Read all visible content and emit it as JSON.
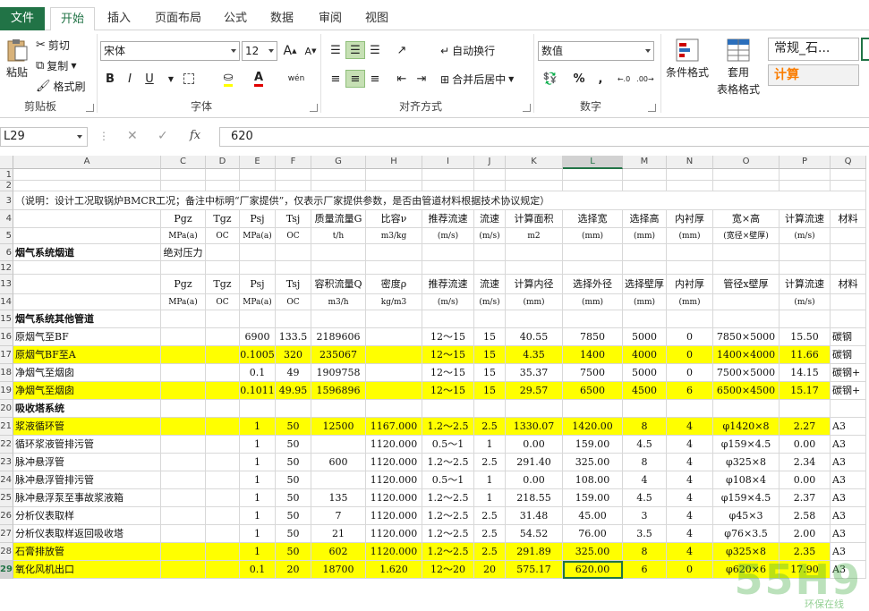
{
  "tabs": [
    {
      "label": "文件",
      "key": "file"
    },
    {
      "label": "开始",
      "key": "home",
      "active": true
    },
    {
      "label": "插入",
      "key": "insert"
    },
    {
      "label": "页面布局",
      "key": "layout"
    },
    {
      "label": "公式",
      "key": "formulas"
    },
    {
      "label": "数据",
      "key": "data"
    },
    {
      "label": "审阅",
      "key": "review"
    },
    {
      "label": "视图",
      "key": "view"
    }
  ],
  "ribbon": {
    "clipboard": {
      "paste": "粘贴",
      "cut": "剪切",
      "copy": "复制",
      "format_painter": "格式刷",
      "label": "剪贴板"
    },
    "font": {
      "name": "宋体",
      "size": "12",
      "label": "字体",
      "bold": "B",
      "italic": "I",
      "underline": "U",
      "grow": "A",
      "shrink": "A",
      "phonetic": "wén"
    },
    "alignment": {
      "wrap": "自动换行",
      "merge": "合并后居中",
      "label": "对齐方式"
    },
    "number": {
      "format": "数值",
      "percent": "%",
      "comma": ",",
      "label": "数字"
    },
    "styles": {
      "conditional": "条件格式",
      "table_format_1": "套用",
      "table_format_2": "表格格式",
      "style_normal": "常规_石...",
      "style_calc": "计算"
    }
  },
  "formula_bar": {
    "name_box": "L29",
    "cancel": "✕",
    "confirm": "✓",
    "fx": "fx",
    "value": "620"
  },
  "columns": [
    "A",
    "C",
    "D",
    "E",
    "F",
    "G",
    "H",
    "I",
    "J",
    "K",
    "L",
    "M",
    "N",
    "O",
    "P",
    "Q"
  ],
  "rows": {
    "r1": "1",
    "r2": "2",
    "r3": "3",
    "r4": "4",
    "r5": "5",
    "r6": "6",
    "r12": "12",
    "r13": "13",
    "r14": "14",
    "r15": "15",
    "r16": "16",
    "r17": "17",
    "r18": "18",
    "r19": "19",
    "r20": "20",
    "r21": "21",
    "r22": "22",
    "r23": "23",
    "r24": "24",
    "r25": "25",
    "r26": "26",
    "r27": "27",
    "r28": "28",
    "r29": "29"
  },
  "sheet": {
    "note": "（说明：设计工况取锅炉BMCR工况；备注中标明“厂家提供”，仅表示厂家提供参数，是否由管道材料根据技术协议规定）",
    "hdr1": {
      "c": "Pgz",
      "d": "Tgz",
      "e": "Psj",
      "f": "Tsj",
      "g": "质量流量G",
      "h": "比容ν",
      "i": "推荐流速",
      "j": "流速",
      "k": "计算面积",
      "l": "选择宽",
      "m": "选择高",
      "n": "内衬厚",
      "o": "宽×高",
      "p": "计算流速",
      "q": "材料"
    },
    "hdr1u": {
      "c": "MPa(a)",
      "d": "OC",
      "e": "MPa(a)",
      "f": "OC",
      "g": "t/h",
      "h": "m3/kg",
      "i": "(m/s)",
      "j": "(m/s)",
      "k": "m2",
      "l": "(mm)",
      "m": "(mm)",
      "n": "(mm)",
      "o": "(宽径×壁厚)",
      "p": "(m/s)"
    },
    "section1": "烟气系统烟道",
    "abs_pressure": "绝对压力",
    "hdr2": {
      "c": "Pgz",
      "d": "Tgz",
      "e": "Psj",
      "f": "Tsj",
      "g": "容积流量Q",
      "h": "密度ρ",
      "i": "推荐流速",
      "j": "流速",
      "k": "计算内径",
      "l": "选择外径",
      "m": "选择壁厚",
      "n": "内衬厚",
      "o": "管径x壁厚",
      "p": "计算流速",
      "q": "材料"
    },
    "hdr2u": {
      "c": "MPa(a)",
      "d": "OC",
      "e": "MPa(a)",
      "f": "OC",
      "g": "m3/h",
      "h": "kg/m3",
      "i": "(m/s)",
      "j": "(m/s)",
      "k": "(mm)",
      "l": "(mm)",
      "m": "(mm)",
      "n": "(mm)",
      "p": "(m/s)"
    },
    "section2": "烟气系统其他管道",
    "section3": "吸收塔系统",
    "data_rows": [
      {
        "row": "16",
        "yellow": false,
        "a": "原烟气至BF",
        "e": "6900",
        "f": "133.5",
        "g": "2189606",
        "h": "",
        "i": "12～15",
        "j": "15",
        "k": "40.55",
        "l": "7850",
        "m": "5000",
        "n": "0",
        "o": "7850×5000",
        "p": "15.50",
        "q": "碳钢"
      },
      {
        "row": "17",
        "yellow": true,
        "a": "原烟气BF至A",
        "e": "0.1005",
        "f": "320",
        "g": "235067",
        "h": "",
        "i": "12～15",
        "j": "15",
        "k": "4.35",
        "l": "1400",
        "m": "4000",
        "n": "0",
        "o": "1400×4000",
        "p": "11.66",
        "q": "碳钢"
      },
      {
        "row": "18",
        "yellow": false,
        "a": "净烟气至烟囱",
        "e": "0.1",
        "f": "49",
        "g": "1909758",
        "h": "",
        "i": "12～15",
        "j": "15",
        "k": "35.37",
        "l": "7500",
        "m": "5000",
        "n": "0",
        "o": "7500×5000",
        "p": "14.15",
        "q": "碳钢+"
      },
      {
        "row": "19",
        "yellow": true,
        "a": "净烟气至烟囱",
        "e": "0.1011",
        "f": "49.95",
        "g": "1596896",
        "h": "",
        "i": "12～15",
        "j": "15",
        "k": "29.57",
        "l": "6500",
        "m": "4500",
        "n": "6",
        "o": "6500×4500",
        "p": "15.17",
        "q": "碳钢+"
      },
      {
        "row": "21",
        "yellow": true,
        "a": "浆液循环管",
        "e": "1",
        "f": "50",
        "g": "12500",
        "h": "1167.000",
        "i": "1.2～2.5",
        "j": "2.5",
        "k": "1330.07",
        "l": "1420.00",
        "m": "8",
        "n": "4",
        "o": "φ1420×8",
        "p": "2.27",
        "q": "A3"
      },
      {
        "row": "22",
        "yellow": false,
        "a": "循环浆液管排污管",
        "e": "1",
        "f": "50",
        "g": "",
        "h": "1120.000",
        "i": "0.5～1",
        "j": "1",
        "k": "0.00",
        "l": "159.00",
        "m": "4.5",
        "n": "4",
        "o": "φ159×4.5",
        "p": "0.00",
        "q": "A3"
      },
      {
        "row": "23",
        "yellow": false,
        "a": "脉冲悬浮管",
        "e": "1",
        "f": "50",
        "g": "600",
        "h": "1120.000",
        "i": "1.2～2.5",
        "j": "2.5",
        "k": "291.40",
        "l": "325.00",
        "m": "8",
        "n": "4",
        "o": "φ325×8",
        "p": "2.34",
        "q": "A3"
      },
      {
        "row": "24",
        "yellow": false,
        "a": "脉冲悬浮管排污管",
        "e": "1",
        "f": "50",
        "g": "",
        "h": "1120.000",
        "i": "0.5～1",
        "j": "1",
        "k": "0.00",
        "l": "108.00",
        "m": "4",
        "n": "4",
        "o": "φ108×4",
        "p": "0.00",
        "q": "A3"
      },
      {
        "row": "25",
        "yellow": false,
        "a": "脉冲悬浮泵至事故浆液箱",
        "e": "1",
        "f": "50",
        "g": "135",
        "h": "1120.000",
        "i": "1.2～2.5",
        "j": "1",
        "k": "218.55",
        "l": "159.00",
        "m": "4.5",
        "n": "4",
        "o": "φ159×4.5",
        "p": "2.37",
        "q": "A3"
      },
      {
        "row": "26",
        "yellow": false,
        "a": "分析仪表取样",
        "e": "1",
        "f": "50",
        "g": "7",
        "h": "1120.000",
        "i": "1.2～2.5",
        "j": "2.5",
        "k": "31.48",
        "l": "45.00",
        "m": "3",
        "n": "4",
        "o": "φ45×3",
        "p": "2.58",
        "q": "A3"
      },
      {
        "row": "27",
        "yellow": false,
        "a": "分析仪表取样返回吸收塔",
        "e": "1",
        "f": "50",
        "g": "21",
        "h": "1120.000",
        "i": "1.2～2.5",
        "j": "2.5",
        "k": "54.52",
        "l": "76.00",
        "m": "3.5",
        "n": "4",
        "o": "φ76×3.5",
        "p": "2.00",
        "q": "A3"
      },
      {
        "row": "28",
        "yellow": true,
        "a": "石膏排放管",
        "e": "1",
        "f": "50",
        "g": "602",
        "h": "1120.000",
        "i": "1.2～2.5",
        "j": "2.5",
        "k": "291.89",
        "l": "325.00",
        "m": "8",
        "n": "4",
        "o": "φ325×8",
        "p": "2.35",
        "q": "A3"
      },
      {
        "row": "29",
        "yellow": true,
        "a": "氧化风机出口",
        "e": "0.1",
        "f": "20",
        "g": "18700",
        "h": "1.620",
        "i": "12～20",
        "j": "20",
        "k": "575.17",
        "l": "620.00",
        "m": "6",
        "n": "0",
        "o": "φ620×6",
        "p": "17.90",
        "q": "A3"
      }
    ]
  },
  "watermark": {
    "main": "55H9",
    "sub": "环保在线"
  }
}
